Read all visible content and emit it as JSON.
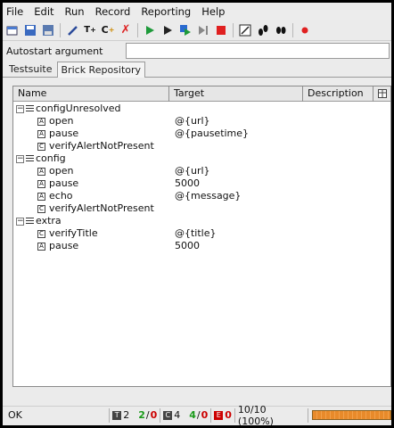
{
  "menu": [
    "File",
    "Edit",
    "Run",
    "Record",
    "Reporting",
    "Help"
  ],
  "autostart": {
    "label": "Autostart argument",
    "value": ""
  },
  "tabs": [
    "Testsuite",
    "Brick Repository"
  ],
  "columns": {
    "name": "Name",
    "target": "Target",
    "description": "Description"
  },
  "tree": [
    {
      "name": "configUnresolved",
      "children": [
        {
          "icon": "A",
          "name": "open",
          "target": "@{url}"
        },
        {
          "icon": "A",
          "name": "pause",
          "target": "@{pausetime}"
        },
        {
          "icon": "C",
          "name": "verifyAlertNotPresent",
          "target": ""
        }
      ]
    },
    {
      "name": "config",
      "children": [
        {
          "icon": "A",
          "name": "open",
          "target": "@{url}"
        },
        {
          "icon": "A",
          "name": "pause",
          "target": "5000"
        },
        {
          "icon": "A",
          "name": "echo",
          "target": "@{message}"
        },
        {
          "icon": "C",
          "name": "verifyAlertNotPresent",
          "target": ""
        }
      ]
    },
    {
      "name": "extra",
      "children": [
        {
          "icon": "C",
          "name": "verifyTitle",
          "target": "@{title}"
        },
        {
          "icon": "A",
          "name": "pause",
          "target": "5000"
        }
      ]
    }
  ],
  "status": {
    "text": "OK",
    "tests": "2",
    "tests_pass": "2",
    "tests_fail": "0",
    "checks": "4",
    "checks_pass": "4",
    "checks_fail": "0",
    "errors": "0",
    "progress_text": "10/10 (100%)",
    "progress": 1.0
  },
  "colors": {
    "pass": "#1a9a1a",
    "fail": "#cc0000",
    "progress": "#e88a2a"
  }
}
